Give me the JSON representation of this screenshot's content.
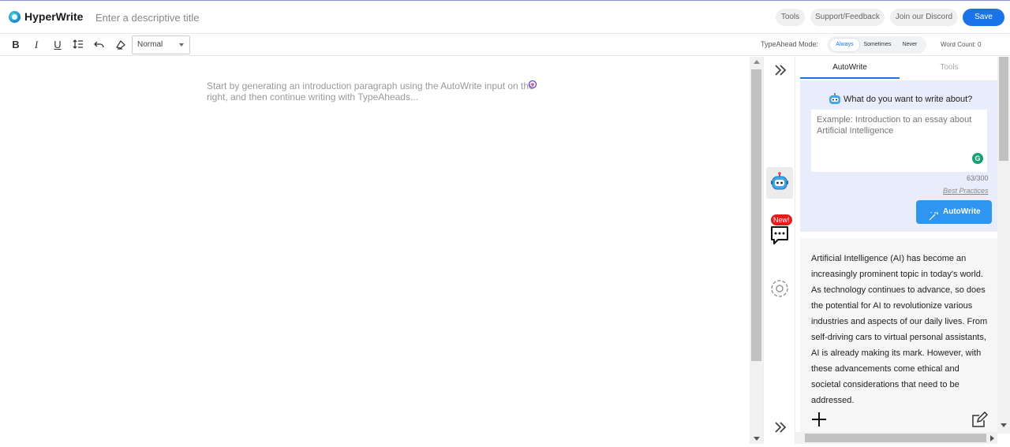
{
  "header": {
    "app_name": "HyperWrite",
    "title_placeholder": "Enter a descriptive title",
    "buttons": [
      "Tools",
      "Support/Feedback",
      "Join our Discord"
    ],
    "save_label": "Save",
    "accent_color": "#1a73e8"
  },
  "toolbar": {
    "icons": [
      "bold-icon",
      "italic-icon",
      "underline-icon",
      "line-spacing-icon",
      "undo-icon",
      "clear-format-icon"
    ],
    "style_select": "Normal",
    "typeahead_label": "TypeAhead Mode:",
    "typeahead_options": [
      "Always",
      "Sometimes",
      "Never"
    ],
    "typeahead_selected": "Always",
    "word_count": "Word Count: 0"
  },
  "editor": {
    "placeholder": "Start by generating an introduction paragraph using the AutoWrite input on the right, and then continue writing with TypeAheads..."
  },
  "rail": {
    "icons": [
      "collapse-panel-icon",
      "robot-icon",
      "chat-icon",
      "settings-icon",
      "expand-panel-icon"
    ],
    "new_badge": "New!"
  },
  "panel": {
    "tabs": [
      "AutoWrite",
      "Tools"
    ],
    "active_tab": "AutoWrite",
    "prompt_title": "What do you want to write about?",
    "prompt_placeholder": "Example: Introduction to an essay about Artificial Intelligence",
    "char_count": "63/300",
    "best_practices": "Best Practices",
    "autowrite_button": "AutoWrite",
    "result_text": "Artificial Intelligence (AI) has become an increasingly prominent topic in today's world. As technology continues to advance, so does the potential for AI to revolutionize various industries and aspects of our daily lives. From self-driving cars to virtual personal assistants, AI is already making its mark. However, with these advancements come ethical and societal considerations that need to be addressed."
  }
}
